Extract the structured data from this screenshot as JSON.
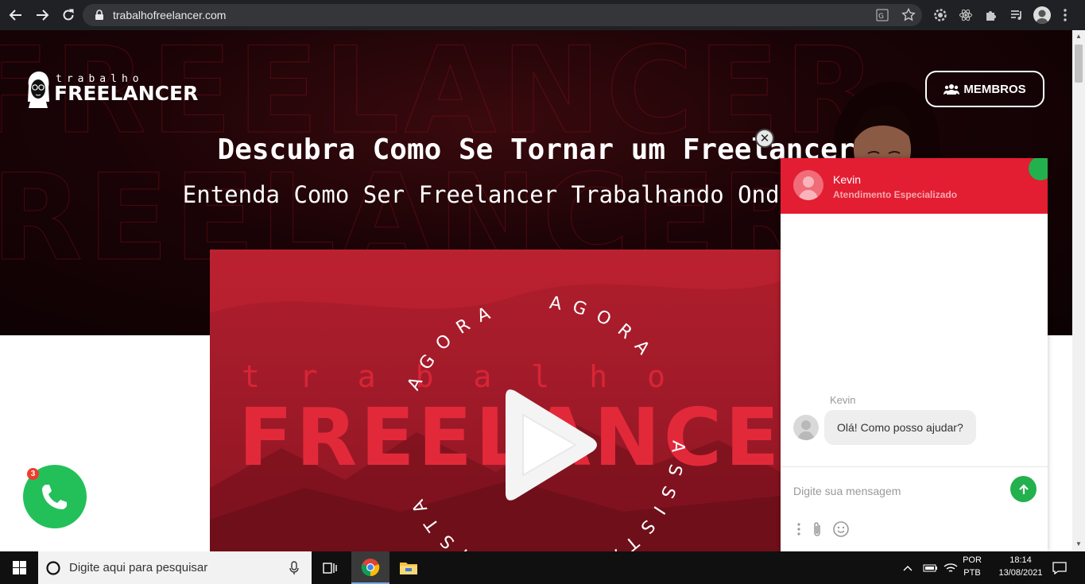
{
  "browser": {
    "url": "trabalhofreelancer.com"
  },
  "site": {
    "logo_small": "trabalho",
    "logo_big": "FREELANCER",
    "members_label": "MEMBROS",
    "headline": "Descubra Como Se Tornar um Freelancer",
    "subline": "Entenda Como Ser Freelancer Trabalhando Onde Quiser"
  },
  "video": {
    "ring_text": "AGORA",
    "ring_text_2": "ASSISTA",
    "brand_small": "trabalho",
    "brand_big": "FREELANCER"
  },
  "chat": {
    "agent_name": "Kevin",
    "agent_role": "Atendimento Especializado",
    "message_sender": "Kevin",
    "message_text": "Olá! Como posso ajudar?",
    "input_placeholder": "Digite sua mensagem",
    "close_symbol": "✕"
  },
  "call_button": {
    "badge_count": "3"
  },
  "taskbar": {
    "search_placeholder": "Digite aqui para pesquisar",
    "lang_1": "POR",
    "lang_2": "PTB",
    "time": "18:14",
    "date": "13/08/2021"
  },
  "colors": {
    "accent_red": "#e31d32",
    "online_green": "#22b14c",
    "call_green": "#23c05a"
  }
}
